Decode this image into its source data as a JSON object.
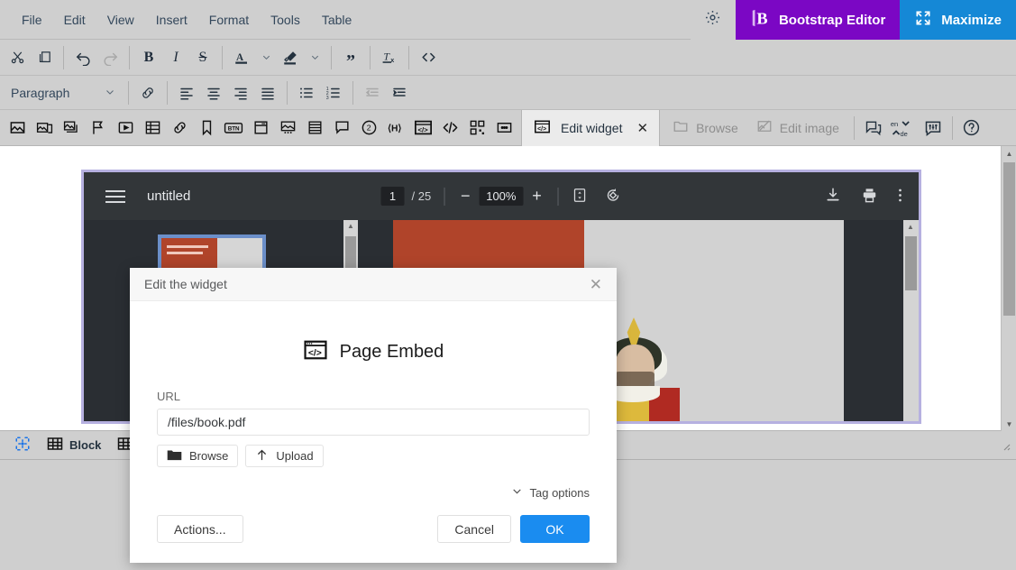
{
  "menubar": {
    "items": [
      {
        "label": "File"
      },
      {
        "label": "Edit"
      },
      {
        "label": "View"
      },
      {
        "label": "Insert"
      },
      {
        "label": "Format"
      },
      {
        "label": "Tools"
      },
      {
        "label": "Table"
      }
    ],
    "settings_icon": "gear-icon",
    "bootstrap_button": {
      "label": "Bootstrap Editor",
      "icon": "bootstrap-b-icon",
      "color": "#7b07c4"
    },
    "maximize_button": {
      "label": "Maximize",
      "icon": "expand-arrows-icon",
      "color": "#1588d6"
    }
  },
  "toolbar_row1": {
    "items": [
      {
        "name": "cut-icon",
        "title": "Cut",
        "disabled": false
      },
      {
        "name": "copy-icon",
        "title": "Copy",
        "disabled": false
      },
      {
        "name": "undo-icon",
        "title": "Undo",
        "disabled": false
      },
      {
        "name": "redo-icon",
        "title": "Redo",
        "disabled": true
      },
      {
        "name": "bold-icon",
        "title": "Bold",
        "label": "B",
        "disabled": false
      },
      {
        "name": "italic-icon",
        "title": "Italic",
        "label": "I",
        "disabled": false
      },
      {
        "name": "strikethrough-icon",
        "title": "Strikethrough",
        "label": "S",
        "disabled": false
      },
      {
        "name": "text-color-icon",
        "title": "Text color",
        "disabled": false
      },
      {
        "name": "text-color-chevron-icon",
        "title": "Text color options",
        "disabled": false
      },
      {
        "name": "highlight-color-icon",
        "title": "Background color",
        "disabled": false
      },
      {
        "name": "highlight-color-chevron-icon",
        "title": "Background color options",
        "disabled": false
      },
      {
        "name": "blockquote-icon",
        "title": "Blockquote",
        "disabled": false
      },
      {
        "name": "clear-formatting-icon",
        "title": "Clear formatting",
        "disabled": false
      },
      {
        "name": "source-code-icon",
        "title": "Source code",
        "disabled": false
      }
    ]
  },
  "toolbar_row2": {
    "format_select": {
      "value": "Paragraph",
      "chevron": "chevron-down-icon"
    },
    "items": [
      {
        "name": "link-icon",
        "title": "Insert link",
        "disabled": false
      },
      {
        "name": "align-left-icon",
        "title": "Align left",
        "disabled": false
      },
      {
        "name": "align-center-icon",
        "title": "Align center",
        "disabled": false
      },
      {
        "name": "align-right-icon",
        "title": "Align right",
        "disabled": false
      },
      {
        "name": "align-justify-icon",
        "title": "Justify",
        "disabled": false
      },
      {
        "name": "bullet-list-icon",
        "title": "Bullet list",
        "disabled": false
      },
      {
        "name": "numbered-list-icon",
        "title": "Numbered list",
        "disabled": false
      },
      {
        "name": "outdent-icon",
        "title": "Decrease indent",
        "disabled": true
      },
      {
        "name": "indent-icon",
        "title": "Increase indent",
        "disabled": false
      }
    ]
  },
  "toolbar_row3": {
    "items": [
      {
        "name": "image-icon",
        "title": "Image"
      },
      {
        "name": "image-gallery-icon",
        "title": "Gallery"
      },
      {
        "name": "layers-icon",
        "title": "Layers"
      },
      {
        "name": "anchor-flag-icon",
        "title": "Anchor"
      },
      {
        "name": "video-icon",
        "title": "Video"
      },
      {
        "name": "table-icon",
        "title": "Table"
      },
      {
        "name": "link-icon",
        "title": "Link"
      },
      {
        "name": "bookmark-icon",
        "title": "Bookmark"
      },
      {
        "name": "button-widget-icon",
        "title": "Button",
        "label": "BTN"
      },
      {
        "name": "card-icon",
        "title": "Card"
      },
      {
        "name": "image-caption-icon",
        "title": "Image with caption"
      },
      {
        "name": "stack-list-icon",
        "title": "List block"
      },
      {
        "name": "comment-icon",
        "title": "Comment"
      },
      {
        "name": "footnote-icon",
        "title": "Footnote",
        "label": "2"
      },
      {
        "name": "html-snippet-icon",
        "title": "HTML snippet"
      },
      {
        "name": "page-embed-icon",
        "title": "Page embed"
      },
      {
        "name": "code-icon",
        "title": "Code"
      },
      {
        "name": "qr-block-icon",
        "title": "Block grid"
      },
      {
        "name": "more-widgets-icon",
        "title": "More"
      }
    ],
    "widget_tab": {
      "label": "Edit widget",
      "icon": "page-embed-icon",
      "close": "close-icon"
    },
    "browse": {
      "label": "Browse",
      "icon": "folder-icon",
      "disabled": true
    },
    "edit_image": {
      "label": "Edit image",
      "icon": "edit-image-icon",
      "disabled": true
    },
    "right_items": [
      {
        "name": "comments-icon",
        "title": "Comments"
      },
      {
        "name": "translate-icon",
        "title": "Translate",
        "from": "en",
        "to": "de"
      },
      {
        "name": "chat-settings-icon",
        "title": "Chat settings"
      },
      {
        "name": "help-icon",
        "title": "Help"
      }
    ]
  },
  "pdf_viewer": {
    "menu_icon": "hamburger-icon",
    "title": "untitled",
    "current_page": "1",
    "page_total": "/ 25",
    "zoom_out_icon": "minus-icon",
    "zoom_level": "100%",
    "zoom_in_icon": "plus-icon",
    "fit_page_icon": "fit-page-icon",
    "rotate_icon": "rotate-icon",
    "download_icon": "download-icon",
    "print_icon": "print-icon",
    "more_icon": "more-vertical-icon"
  },
  "statusbar": {
    "items": [
      {
        "name": "selection-marker-icon",
        "label": ""
      },
      {
        "name": "block-icon",
        "label": "Block"
      },
      {
        "name": "block-grid-icon",
        "label": ""
      }
    ],
    "resize_grip": "resize-grip-icon"
  },
  "dialog": {
    "title": "Edit the widget",
    "close_icon": "close-icon",
    "widget": {
      "name": "Page Embed",
      "icon": "page-embed-icon"
    },
    "url": {
      "label": "URL",
      "value": "/files/book.pdf",
      "placeholder": "URL"
    },
    "browse_button": {
      "label": "Browse",
      "icon": "folder-icon"
    },
    "upload_button": {
      "label": "Upload",
      "icon": "upload-arrow-icon"
    },
    "tag_options": {
      "label": "Tag options",
      "icon": "chevron-down-icon"
    },
    "actions_button": {
      "label": "Actions..."
    },
    "cancel_button": {
      "label": "Cancel"
    },
    "ok_button": {
      "label": "OK",
      "color": "#1a8cf0"
    }
  }
}
